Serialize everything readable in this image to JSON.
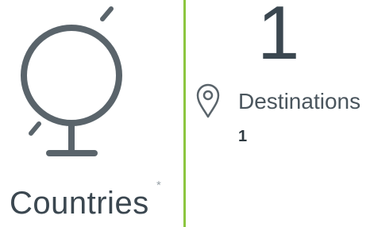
{
  "countries": {
    "label": "Countries",
    "asterisk": "*",
    "icon": "globe-icon"
  },
  "destinations": {
    "big_count": "1",
    "label": "Destinations",
    "count": "1",
    "icon": "map-pin-icon"
  },
  "colors": {
    "accent": "#8cc63f",
    "icon": "#5a646b",
    "text": "#3b4750"
  }
}
